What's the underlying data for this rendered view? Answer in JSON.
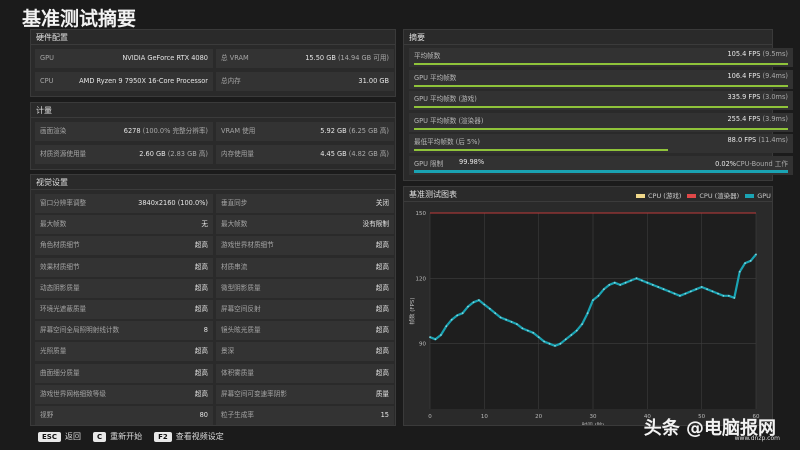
{
  "page_title": "基准测试摘要",
  "hardware": {
    "header": "硬件配置",
    "rows": [
      {
        "k": "GPU",
        "v": "NVIDIA GeForce RTX 4080",
        "sub": ""
      },
      {
        "k": "总 VRAM",
        "v": "15.50 GB",
        "sub": "(14.94 GB 可用)"
      },
      {
        "k": "CPU",
        "v": "AMD Ryzen 9 7950X 16-Core Processor",
        "sub": ""
      },
      {
        "k": "总内存",
        "v": "31.00 GB",
        "sub": ""
      }
    ]
  },
  "metrics": {
    "header": "计量",
    "rows": [
      {
        "k": "画面渲染",
        "v": "6278",
        "sub": "(100.0% 完整分辨率)"
      },
      {
        "k": "VRAM 使用",
        "v": "5.92 GB",
        "sub": "(6.25 GB 高)"
      },
      {
        "k": "材质资源使用量",
        "v": "2.60 GB",
        "sub": "(2.83 GB 高)"
      },
      {
        "k": "内存使用量",
        "v": "4.45 GB",
        "sub": "(4.82 GB 高)"
      }
    ]
  },
  "visual": {
    "header": "视觉设置",
    "left": [
      {
        "k": "窗口分辨率调整",
        "v": "3840x2160 (100.0%)"
      },
      {
        "k": "最大帧数",
        "v": "无"
      },
      {
        "k": "角色材质细节",
        "v": "超高"
      },
      {
        "k": "效果材质细节",
        "v": "超高"
      },
      {
        "k": "动态阴影质量",
        "v": "超高"
      },
      {
        "k": "环境光遮蔽质量",
        "v": "超高"
      },
      {
        "k": "屏幕空间全局照明射线计数",
        "v": "8"
      },
      {
        "k": "光照质量",
        "v": "超高"
      },
      {
        "k": "曲面细分质量",
        "v": "超高"
      },
      {
        "k": "游戏世界网格细致等级",
        "v": "超高"
      },
      {
        "k": "视野",
        "v": "80"
      }
    ],
    "right": [
      {
        "k": "垂直同步",
        "v": "关闭"
      },
      {
        "k": "最大帧数",
        "v": "没有限制"
      },
      {
        "k": "游戏世界材质细节",
        "v": "超高"
      },
      {
        "k": "材质串流",
        "v": "超高"
      },
      {
        "k": "微型阴影质量",
        "v": "超高"
      },
      {
        "k": "屏幕空间反射",
        "v": "超高"
      },
      {
        "k": "镜头眩光质量",
        "v": "超高"
      },
      {
        "k": "景深",
        "v": "超高"
      },
      {
        "k": "体积雾质量",
        "v": "超高"
      },
      {
        "k": "屏幕空间可变速率阴影",
        "v": "质量"
      },
      {
        "k": "粒子生成率",
        "v": "15"
      }
    ]
  },
  "summary": {
    "header": "摘要",
    "rows": [
      {
        "k": "平均帧数",
        "v": "105.4 FPS",
        "sub": "(9.5ms)",
        "frac": 1.0,
        "color": "green"
      },
      {
        "k": "GPU 平均帧数",
        "v": "106.4 FPS",
        "sub": "(9.4ms)",
        "frac": 1.0,
        "color": "green"
      },
      {
        "k": "GPU 平均帧数 (游戏)",
        "v": "335.9 FPS",
        "sub": "(3.0ms)",
        "frac": 1.0,
        "color": "green"
      },
      {
        "k": "GPU 平均帧数 (渲染器)",
        "v": "255.4 FPS",
        "sub": "(3.9ms)",
        "frac": 1.0,
        "color": "green"
      },
      {
        "k": "最低平均帧数 (后 5%)",
        "v": "88.0 FPS",
        "sub": "(11.4ms)",
        "frac": 0.68,
        "color": "green"
      }
    ],
    "limit": {
      "k": "GPU 限制",
      "pct": "99.98%",
      "right": "0.02%",
      "right_label": "CPU-Bound 工作",
      "frac": 0.9998
    }
  },
  "chart_panel": {
    "header": "基准测试图表",
    "legend": [
      {
        "name": "CPU (游戏)",
        "color": "#f0d88a"
      },
      {
        "name": "CPU (渲染器)",
        "color": "#e04848"
      },
      {
        "name": "GPU",
        "color": "#1aa3b3"
      }
    ]
  },
  "chart_data": {
    "type": "line",
    "xlabel": "时间 (秒)",
    "ylabel": "帧数 (FPS)",
    "xlim": [
      0,
      60
    ],
    "ylim": [
      60,
      150
    ],
    "x_ticks": [
      0,
      10,
      20,
      30,
      40,
      50,
      60
    ],
    "y_ticks": [
      90,
      120,
      150
    ],
    "grid": true,
    "series": [
      {
        "name": "GPU",
        "color": "#1aa3b3",
        "x": [
          0,
          1,
          2,
          3,
          4,
          5,
          6,
          7,
          8,
          9,
          10,
          11,
          12,
          13,
          14,
          15,
          16,
          17,
          18,
          19,
          20,
          21,
          22,
          23,
          24,
          25,
          26,
          27,
          28,
          29,
          30,
          31,
          32,
          33,
          34,
          35,
          36,
          37,
          38,
          39,
          40,
          41,
          42,
          43,
          44,
          45,
          46,
          47,
          48,
          49,
          50,
          51,
          52,
          53,
          54,
          55,
          56,
          57,
          58,
          59,
          60
        ],
        "y": [
          93,
          92,
          94,
          98,
          101,
          103,
          104,
          107,
          109,
          110,
          108,
          106,
          104,
          102,
          101,
          100,
          99,
          97,
          96,
          95,
          93,
          91,
          90,
          89,
          90,
          92,
          94,
          96,
          99,
          104,
          110,
          112,
          115,
          117,
          118,
          117,
          118,
          119,
          120,
          119,
          118,
          117,
          116,
          115,
          114,
          113,
          112,
          113,
          114,
          115,
          116,
          115,
          114,
          113,
          112,
          112,
          111,
          123,
          127,
          128,
          131
        ]
      }
    ]
  },
  "footer": [
    {
      "key": "ESC",
      "label": "返回"
    },
    {
      "key": "C",
      "label": "重新开始"
    },
    {
      "key": "F2",
      "label": "查看视频设定"
    }
  ],
  "watermark": {
    "main": "头条 @电脑报网",
    "sub": "www.dnzp.com"
  }
}
